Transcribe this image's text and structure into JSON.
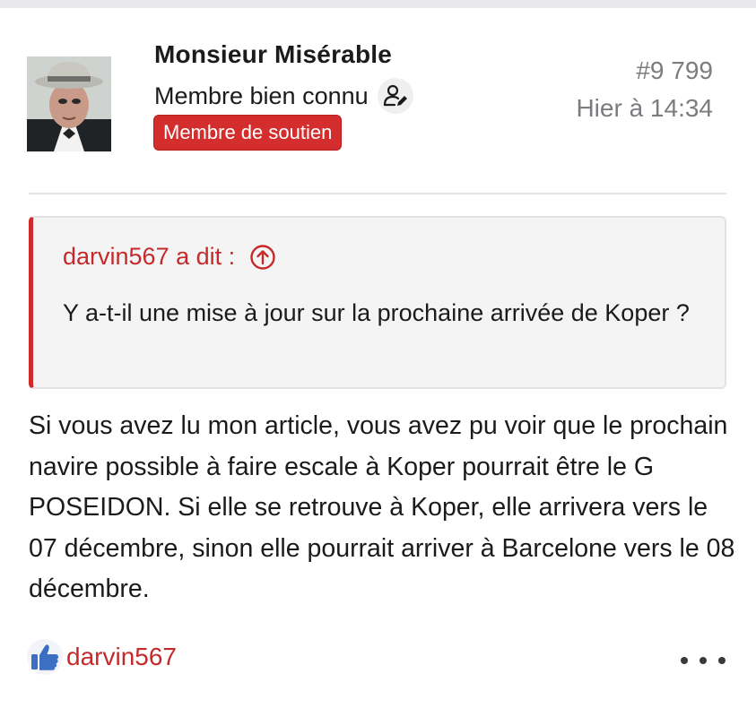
{
  "post": {
    "author": {
      "name": "Monsieur Misérable",
      "title": "Membre bien connu",
      "badge": "Membre de soutien",
      "avatar": "avatar-photo",
      "title_icon": "user-edit-icon"
    },
    "number": "#9 799",
    "time": "Hier à 14:34",
    "quote": {
      "author_label": "darvin567 a dit :",
      "jump_icon": "arrow-up-circle-icon",
      "text": "Y a-t-il une mise à jour sur la prochaine arrivée de Koper ?"
    },
    "body": "Si vous avez lu mon article, vous avez pu voir que le prochain navire possible à faire escale à Koper pourrait être le G POSEIDON. Si elle se retrouve à Koper, elle arrivera vers le 07 décembre, sinon elle pourrait arriver à Barcelone vers le 08 décembre.",
    "reactions": {
      "icon": "thumbs-up-icon",
      "users": "darvin567"
    },
    "more_icon": "more-dots-icon"
  },
  "colors": {
    "accent_red": "#c52a2a",
    "badge_red": "#d32d2d",
    "muted_text": "#7b7b80",
    "like_blue": "#3b6fc4"
  }
}
